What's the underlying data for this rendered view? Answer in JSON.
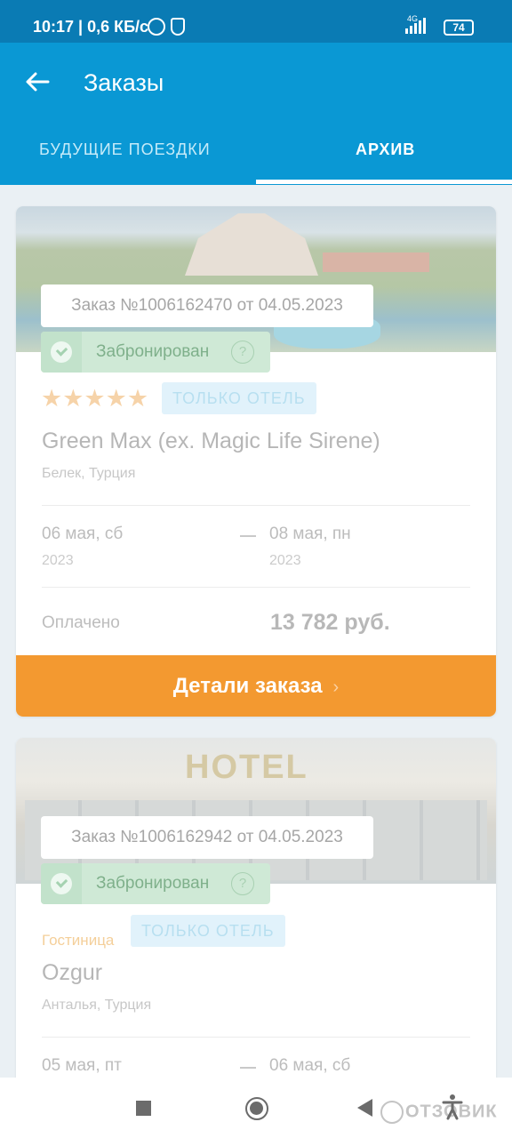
{
  "status_bar": {
    "text": "10:17 | 0,6 КБ/с",
    "network": "4G",
    "battery": "74"
  },
  "header": {
    "title": "Заказы"
  },
  "tabs": [
    {
      "label": "БУДУЩИЕ ПОЕЗДКИ",
      "active": false
    },
    {
      "label": "АРХИВ",
      "active": true
    }
  ],
  "orders": [
    {
      "order_label": "Заказ №1006162470 от 04.05.2023",
      "status": "Забронирован",
      "help_icon": "?",
      "stars": "★★★★★",
      "type": "ТОЛЬКО ОТЕЛЬ",
      "hotel": "Green Max (ex. Magic Life Sirene)",
      "location": "Белек, Турция",
      "date_from": "06 мая, сб",
      "year_from": "2023",
      "date_to": "08 мая, пн",
      "year_to": "2023",
      "paid_label": "Оплачено",
      "price": "13 782 руб.",
      "details_button": "Детали заказа",
      "details_chevron": "›"
    },
    {
      "order_label": "Заказ №1006162942 от 04.05.2023",
      "status": "Забронирован",
      "help_icon": "?",
      "category": "Гостиница",
      "type": "ТОЛЬКО ОТЕЛЬ",
      "hotel": "Ozgur",
      "location": "Анталья, Турция",
      "date_from": "05 мая, пт",
      "date_to": "06 мая, сб",
      "photo_sign": "HOTEL"
    }
  ],
  "watermark": "ОТЗОВИК",
  "colors": {
    "primary": "#0a98d4",
    "status_bar": "#0a7bb4",
    "accent": "#f39930",
    "booked": "#cfe9d6"
  }
}
